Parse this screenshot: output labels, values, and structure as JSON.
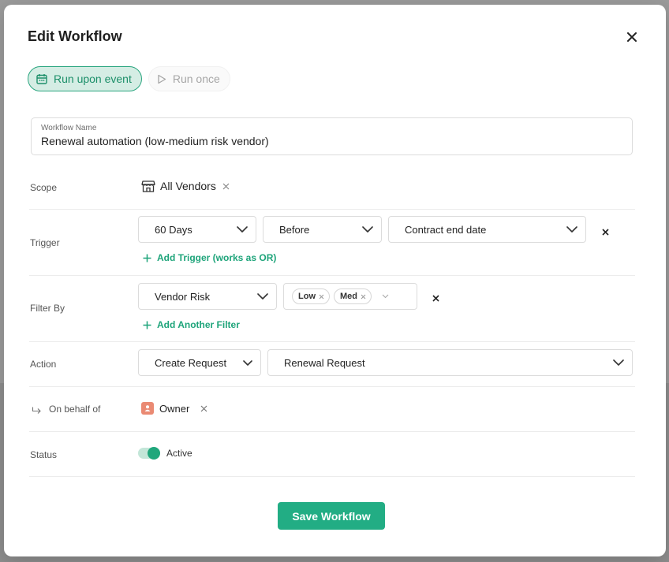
{
  "modal": {
    "title": "Edit Workflow"
  },
  "mode_tabs": [
    {
      "label": "Run upon event",
      "icon": "calendar-icon",
      "active": true
    },
    {
      "label": "Run once",
      "icon": "play-icon",
      "active": false
    }
  ],
  "workflow_name": {
    "label": "Workflow Name",
    "value": "Renewal automation (low-medium risk vendor)"
  },
  "scope": {
    "label": "Scope",
    "value": "All Vendors",
    "icon": "store-icon"
  },
  "trigger": {
    "label": "Trigger",
    "duration": "60 Days",
    "relation": "Before",
    "event": "Contract end date",
    "add_label": "Add Trigger (works as OR)"
  },
  "filter": {
    "label": "Filter By",
    "field": "Vendor Risk",
    "values": [
      "Low",
      "Med"
    ],
    "add_label": "Add Another Filter"
  },
  "action": {
    "label": "Action",
    "type": "Create Request",
    "request": "Renewal Request"
  },
  "on_behalf": {
    "label": "On behalf of",
    "value": "Owner",
    "icon": "person-icon"
  },
  "status": {
    "label": "Status",
    "value": "Active",
    "enabled": true
  },
  "save_label": "Save Workflow",
  "colors": {
    "accent": "#22ad84",
    "accent_light": "#d5ede4",
    "avatar": "#ea8a73"
  }
}
